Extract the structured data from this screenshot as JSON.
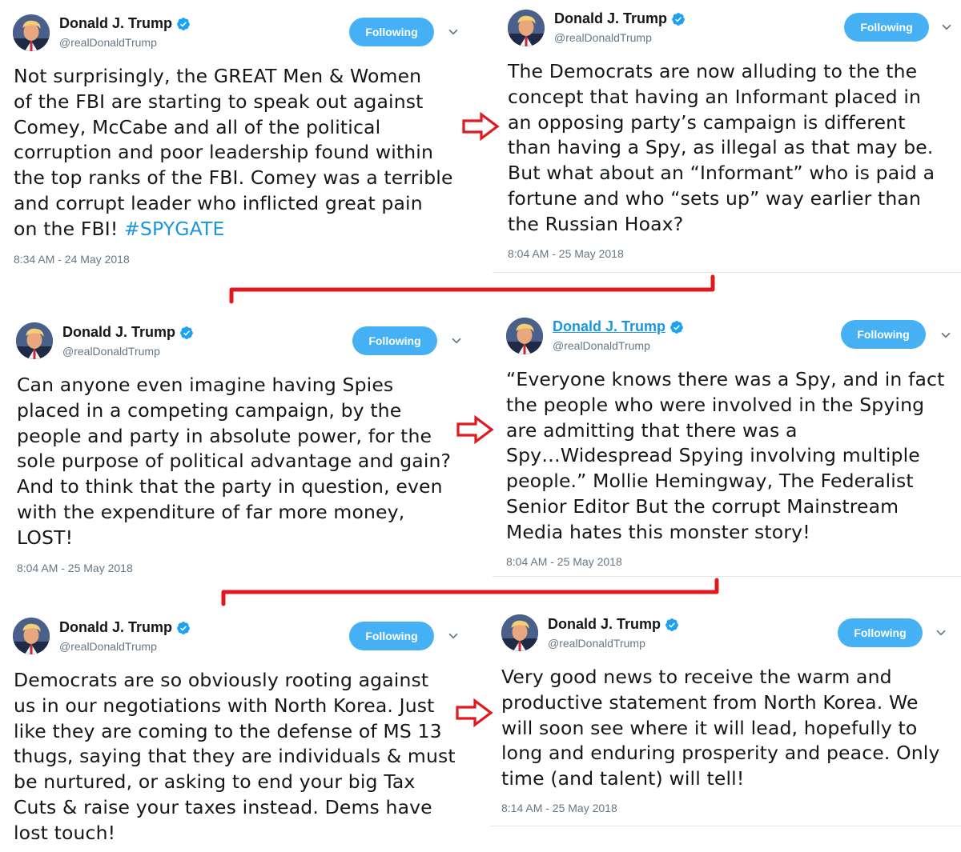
{
  "tweets": [
    {
      "name": "Donald J. Trump",
      "handle": "@realDonaldTrump",
      "follow_label": "Following",
      "text": "Not surprisingly, the GREAT Men & Women\nof the FBI are starting to speak out against\nComey, McCabe and all of the political\ncorruption and poor leadership found within\nthe top ranks of the FBI. Comey was a terrible\nand corrupt leader who inflicted great pain\non the FBI! ",
      "hashtag": "#SPYGATE",
      "timestamp": "8:34 AM - 24 May 2018"
    },
    {
      "name": "Donald J. Trump",
      "handle": "@realDonaldTrump",
      "follow_label": "Following",
      "text": "The Democrats are now alluding to the the\nconcept that having an Informant placed in\nan opposing party’s campaign is different\nthan having a Spy, as illegal as that may be.\nBut what about an “Informant” who is paid a\nfortune and who “sets up” way earlier than\nthe Russian Hoax?",
      "timestamp": "8:04 AM - 25 May 2018"
    },
    {
      "name": "Donald J. Trump",
      "handle": "@realDonaldTrump",
      "follow_label": "Following",
      "text": "Can anyone even imagine having Spies\nplaced in a competing campaign, by the\npeople and party in absolute power, for the\nsole purpose of political advantage and gain?\nAnd to think that the party in question, even\nwith the expenditure of far more money,\nLOST!",
      "timestamp": "8:04 AM - 25 May 2018"
    },
    {
      "name": "Donald J. Trump",
      "handle": "@realDonaldTrump",
      "follow_label": "Following",
      "text": "“Everyone knows there was a Spy, and in fact\nthe people who were involved in the Spying\nare admitting that there was a\nSpy…Widespread Spying involving multiple\npeople.” Mollie Hemingway, The Federalist\nSenior Editor  But the corrupt Mainstream\nMedia hates this monster story!",
      "timestamp": "8:04 AM - 25 May 2018"
    },
    {
      "name": "Donald J. Trump",
      "handle": "@realDonaldTrump",
      "follow_label": "Following",
      "text": "Democrats are so obviously rooting against\nus in our negotiations with North Korea. Just\nlike they are coming to the defense of MS 13\nthugs, saying that they are individuals & must\nbe nurtured, or asking to end your big Tax\nCuts & raise your taxes instead. Dems have\nlost touch!"
    },
    {
      "name": "Donald J. Trump",
      "handle": "@realDonaldTrump",
      "follow_label": "Following",
      "text": "Very good news to receive the warm and\nproductive statement from North Korea. We\nwill soon see where it will lead, hopefully to\nlong and enduring prosperity and peace. Only\ntime (and talent) will tell!",
      "timestamp": "8:14 AM - 25 May 2018"
    }
  ],
  "icons": {
    "verified": "verified-badge-icon",
    "chevron": "chevron-down-icon",
    "arrow": "right-arrow-icon"
  },
  "colors": {
    "follow_button": "#1da1f2",
    "hashtag": "#1b95e0",
    "verified_badge": "#1da1f2",
    "annotation": "#e0181f",
    "meta_text": "#657786"
  }
}
